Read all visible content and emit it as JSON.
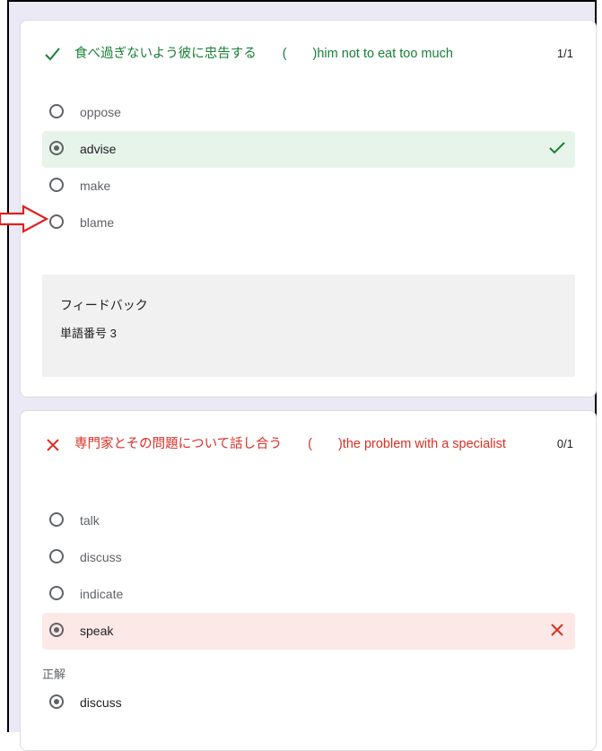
{
  "q1": {
    "text": "食べ過ぎないよう彼に忠告する　　(　　)him not to eat too much",
    "score": "1/1",
    "options": [
      {
        "label": "oppose"
      },
      {
        "label": "advise"
      },
      {
        "label": "make"
      },
      {
        "label": "blame"
      }
    ],
    "feedback_title": "フィードバック",
    "feedback_body": "単語番号 3"
  },
  "q2": {
    "text": "専門家とその問題について話し合う　　(　　)the problem with a specialist",
    "score": "0/1",
    "options": [
      {
        "label": "talk"
      },
      {
        "label": "discuss"
      },
      {
        "label": "indicate"
      },
      {
        "label": "speak"
      }
    ],
    "answer_label": "正解",
    "correct_answer": "discuss"
  },
  "icons": {
    "correct": "check-icon",
    "wrong": "x-icon",
    "annotation": "red-arrow-icon"
  },
  "colors": {
    "correct": "#188038",
    "wrong": "#d93025",
    "correct_bg": "#e6f4ea",
    "wrong_bg": "#fce8e6",
    "page_bg": "#ece9f6"
  }
}
